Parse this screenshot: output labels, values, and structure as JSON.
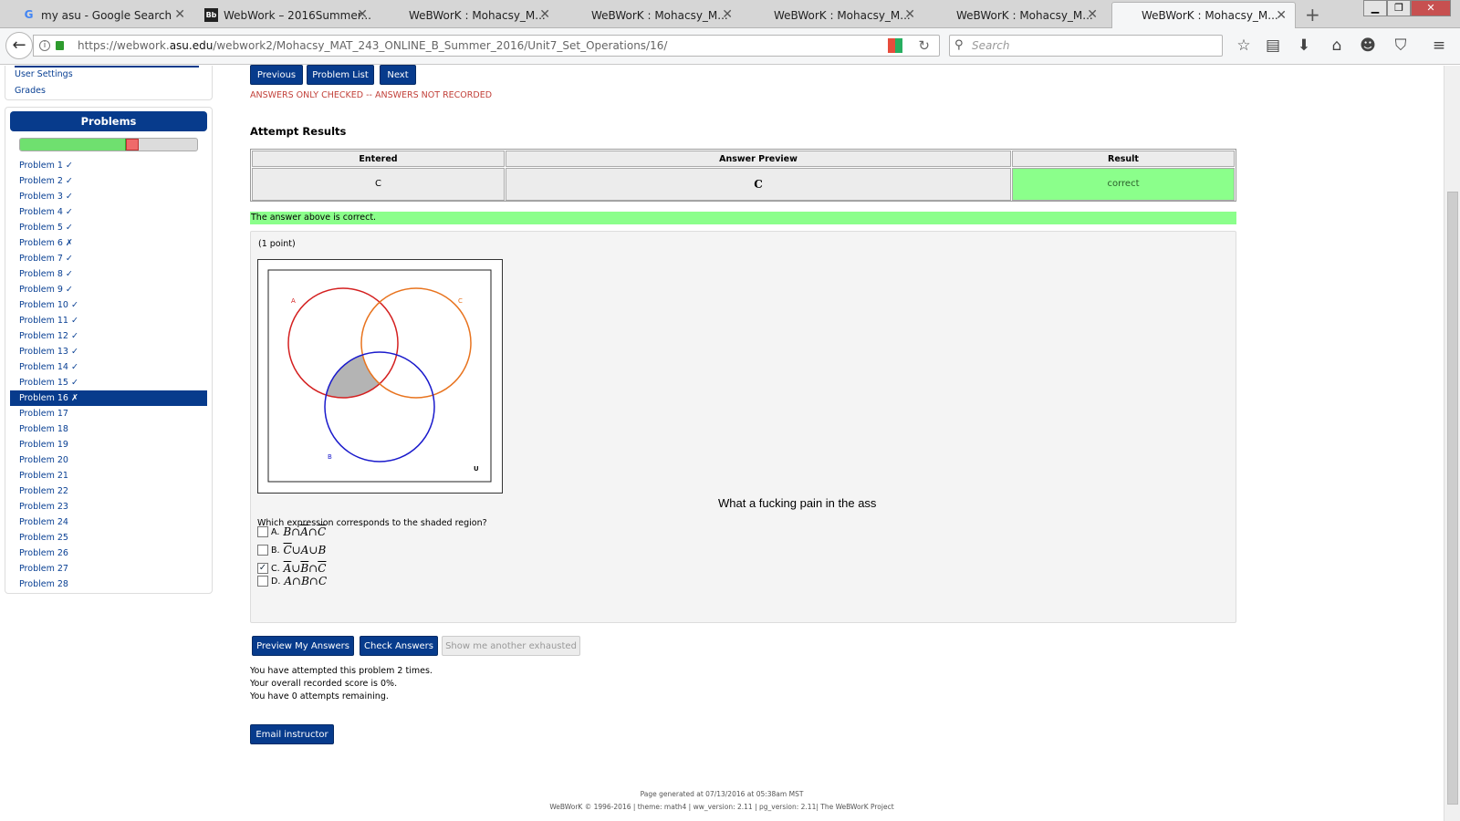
{
  "browser": {
    "tabs": [
      {
        "label": "my asu - Google Search",
        "icon": "G"
      },
      {
        "label": "WebWork – 2016Summer...",
        "icon": "Bb"
      },
      {
        "label": "WeBWorK : Mohacsy_M...",
        "icon": ""
      },
      {
        "label": "WeBWorK : Mohacsy_M...",
        "icon": ""
      },
      {
        "label": "WeBWorK : Mohacsy_M...",
        "icon": ""
      },
      {
        "label": "WeBWorK : Mohacsy_M...",
        "icon": ""
      },
      {
        "label": "WeBWorK : Mohacsy_M...",
        "icon": ""
      }
    ],
    "url_prefix": "https://webwork.",
    "url_domain": "asu.edu",
    "url_path": "/webwork2/Mohacsy_MAT_243_ONLINE_B_Summer_2016/Unit7_Set_Operations/16/",
    "search_placeholder": "Search"
  },
  "sidebar": {
    "links": [
      "User Settings",
      "Grades"
    ],
    "problems_header": "Problems",
    "progress": {
      "correct_fraction": 0.6,
      "incorrect_fraction": 0.07
    },
    "problems": [
      "Problem 1 ✓",
      "Problem 2 ✓",
      "Problem 3 ✓",
      "Problem 4 ✓",
      "Problem 5 ✓",
      "Problem 6 ✗",
      "Problem 7 ✓",
      "Problem 8 ✓",
      "Problem 9 ✓",
      "Problem 10 ✓",
      "Problem 11 ✓",
      "Problem 12 ✓",
      "Problem 13 ✓",
      "Problem 14 ✓",
      "Problem 15 ✓",
      "Problem 16 ✗",
      "Problem 17",
      "Problem 18",
      "Problem 19",
      "Problem 20",
      "Problem 21",
      "Problem 22",
      "Problem 23",
      "Problem 24",
      "Problem 25",
      "Problem 26",
      "Problem 27",
      "Problem 28"
    ],
    "current_index": 15
  },
  "nav": {
    "previous": "Previous",
    "problem_list": "Problem List",
    "next": "Next"
  },
  "notice": "ANSWERS ONLY CHECKED -- ANSWERS NOT RECORDED",
  "attempt": {
    "title": "Attempt Results",
    "headers": [
      "Entered",
      "Answer Preview",
      "Result"
    ],
    "entered": "C",
    "preview": "C",
    "result": "correct",
    "message": "The answer above is correct."
  },
  "problem": {
    "points": "(1 point)",
    "venn_labels": {
      "a": "A",
      "b": "B",
      "c": "C",
      "u": "U"
    },
    "comment": "What a fucking pain in the ass",
    "question": "Which expression corresponds to the shaded region?",
    "choices": [
      {
        "letter": "A.",
        "expr": [
          "B",
          "∩",
          "A",
          "∩",
          "C"
        ],
        "over": [
          false,
          false,
          true,
          false,
          true
        ],
        "checked": false
      },
      {
        "letter": "B.",
        "expr": [
          "C",
          "∪",
          "A",
          "∪",
          "B"
        ],
        "over": [
          true,
          false,
          false,
          false,
          false
        ],
        "checked": false
      },
      {
        "letter": "C.",
        "expr": [
          "A",
          "∪",
          "B",
          "∩",
          "C"
        ],
        "over": [
          true,
          false,
          true,
          false,
          true
        ],
        "checked": true
      },
      {
        "letter": "D.",
        "expr": [
          "A",
          "∩",
          "B",
          "∩",
          "C"
        ],
        "over": [
          false,
          false,
          false,
          false,
          false
        ],
        "checked": false
      }
    ]
  },
  "actions": {
    "preview": "Preview My Answers",
    "check": "Check Answers",
    "another": "Show me another exhausted"
  },
  "status": [
    "You have attempted this problem 2 times.",
    "Your overall recorded score is 0%.",
    "You have 0 attempts remaining."
  ],
  "email": "Email instructor",
  "footer": {
    "line1": "Page generated at 07/13/2016 at 05:38am MST",
    "line2": "WeBWorK © 1996-2016 | theme: math4 | ww_version: 2.11 | pg_version: 2.11| The WeBWorK Project"
  }
}
